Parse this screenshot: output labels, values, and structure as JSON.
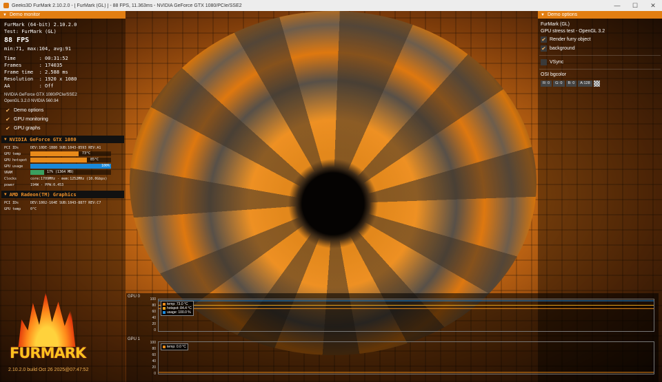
{
  "window": {
    "title": "Geeks3D FurMark 2.10.2.0 - [ FurMark (GL) ] - 88 FPS, 11.363ms - NVIDIA GeForce GTX 1080/PCIe/SSE2",
    "minimize": "—",
    "maximize": "☐",
    "close": "✕"
  },
  "left_panel": {
    "header": "Demo monitor",
    "app_line": "FurMark (64-bit) 2.10.2.0",
    "test_line": "Test: FurMark (GL)",
    "fps": "88 FPS",
    "fps_stats": "min:71, max:104, avg:91",
    "stats": [
      "Time        : 00:31:52",
      "Frames      : 174035",
      "Frame time  : 2.588 ms",
      "Resolution  : 1920 x 1080",
      "AA          : Off"
    ],
    "renderer": "NVIDIA GeForce GTX 1080/PCIe/SSE2",
    "opengl": "OpenGL 3.2.0 NVIDIA 560.94",
    "options": [
      {
        "label": "Demo options"
      },
      {
        "label": "GPU monitoring"
      },
      {
        "label": "GPU graphs"
      }
    ],
    "gpu1": {
      "name": "NVIDIA GeForce GTX 1080",
      "pci_label": "PCI IDs",
      "pci_value": "DEV:10DE-1B80 SUB:1043-8593 REV:A1",
      "temp_label": "GPU temp",
      "temp_value": "73°C",
      "temp_fraction": 0.6,
      "hotspot_label": "GPU hotspot",
      "hotspot_value": "85°C",
      "hotspot_fraction": 0.7,
      "usage_label": "GPU usage",
      "usage_value": "100%",
      "usage_fraction": 1.0,
      "vram_label": "VRAM",
      "vram_value": "17% (1364 MB)",
      "vram_fraction": 0.17,
      "clocks_label": "Clocks",
      "clocks_value": "core:1709MHz - mem:1252MHz (10.0Gbps)",
      "power_label": "power",
      "power_value": "194W - PPW:0.453"
    },
    "gpu2": {
      "name": "AMD Radeon(TM) Graphics",
      "pci_label": "PCI IDs",
      "pci_value": "DEV:1002-164E SUB:1043-8877 REV:C7",
      "temp_label": "GPU temp",
      "temp_value": "0°C"
    },
    "logo_text": "FURMARK",
    "build": "2.10.2.0 build Oct 26 2025@07:47:52"
  },
  "right_panel": {
    "header": "Demo options",
    "title": "FurMark (GL)",
    "subtitle": "GPU stress test - OpenGL 3.2",
    "checks": [
      {
        "label": "Render furry object",
        "checked": true
      },
      {
        "label": "background",
        "checked": true
      }
    ],
    "vsync_label": "VSync",
    "osi_label": "OSI bgcolor",
    "bgcolor": {
      "r": "R: 0",
      "g": "G: 0",
      "b": "B: 0",
      "a": "A:128"
    }
  },
  "graphs": {
    "gpu0_title": "GPU 0",
    "gpu1_title": "GPU 1",
    "y_ticks": [
      "100",
      "80",
      "60",
      "40",
      "20",
      "0"
    ],
    "gpu0_legend": [
      {
        "label": "temp: 73.0 °C",
        "color": "#e88a1a"
      },
      {
        "label": "hotspot: 84.4 °C",
        "color": "#e8a01a"
      },
      {
        "label": "usage: 100.0 %",
        "color": "#1a8ae0"
      }
    ],
    "gpu1_legend": [
      {
        "label": "temp: 0.0 °C",
        "color": "#e88a1a"
      }
    ],
    "series_values": {
      "gpu0_temp": 73.0,
      "gpu0_hotspot": 84.4,
      "gpu0_usage": 100.0,
      "gpu1_temp": 0.0
    }
  },
  "colors": {
    "accent": "#e27e12",
    "usage_bar": "#1a88d8",
    "vram_bar": "#3aa060",
    "temp_bar": "#e88a1a"
  }
}
